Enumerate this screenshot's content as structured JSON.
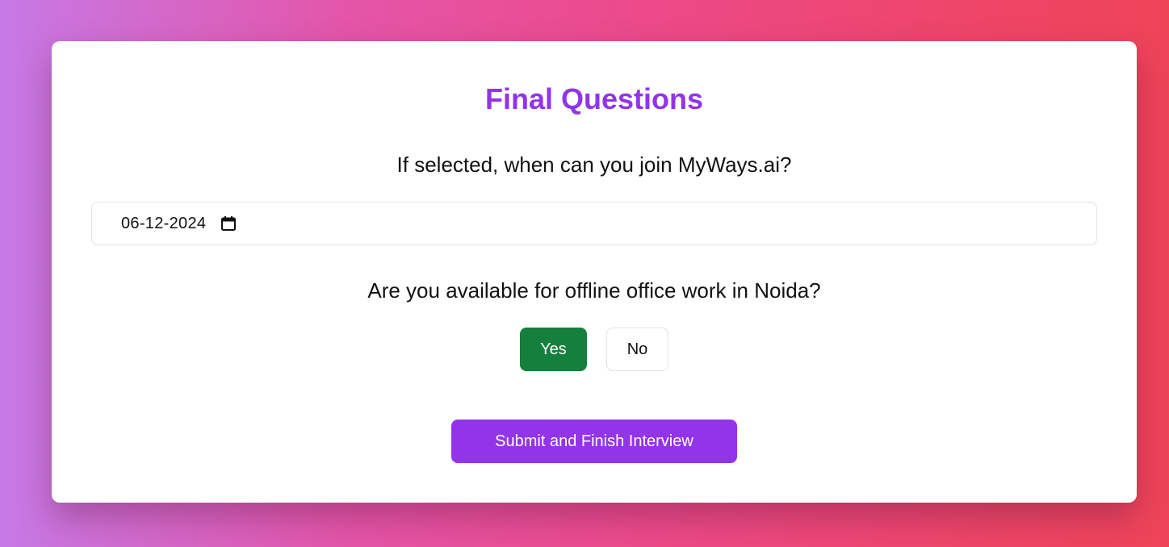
{
  "form": {
    "title": "Final Questions",
    "join_question": "If selected, when can you join MyWays.ai?",
    "join_date_value": "06-12-2024",
    "office_question": "Are you available for offline office work in Noida?",
    "options": {
      "yes_label": "Yes",
      "no_label": "No",
      "selected": "Yes"
    },
    "submit_label": "Submit and Finish Interview"
  },
  "icons": {
    "date_picker": "calendar-icon"
  },
  "colors": {
    "accent": "#9333ea",
    "selected_option": "#15803d"
  }
}
